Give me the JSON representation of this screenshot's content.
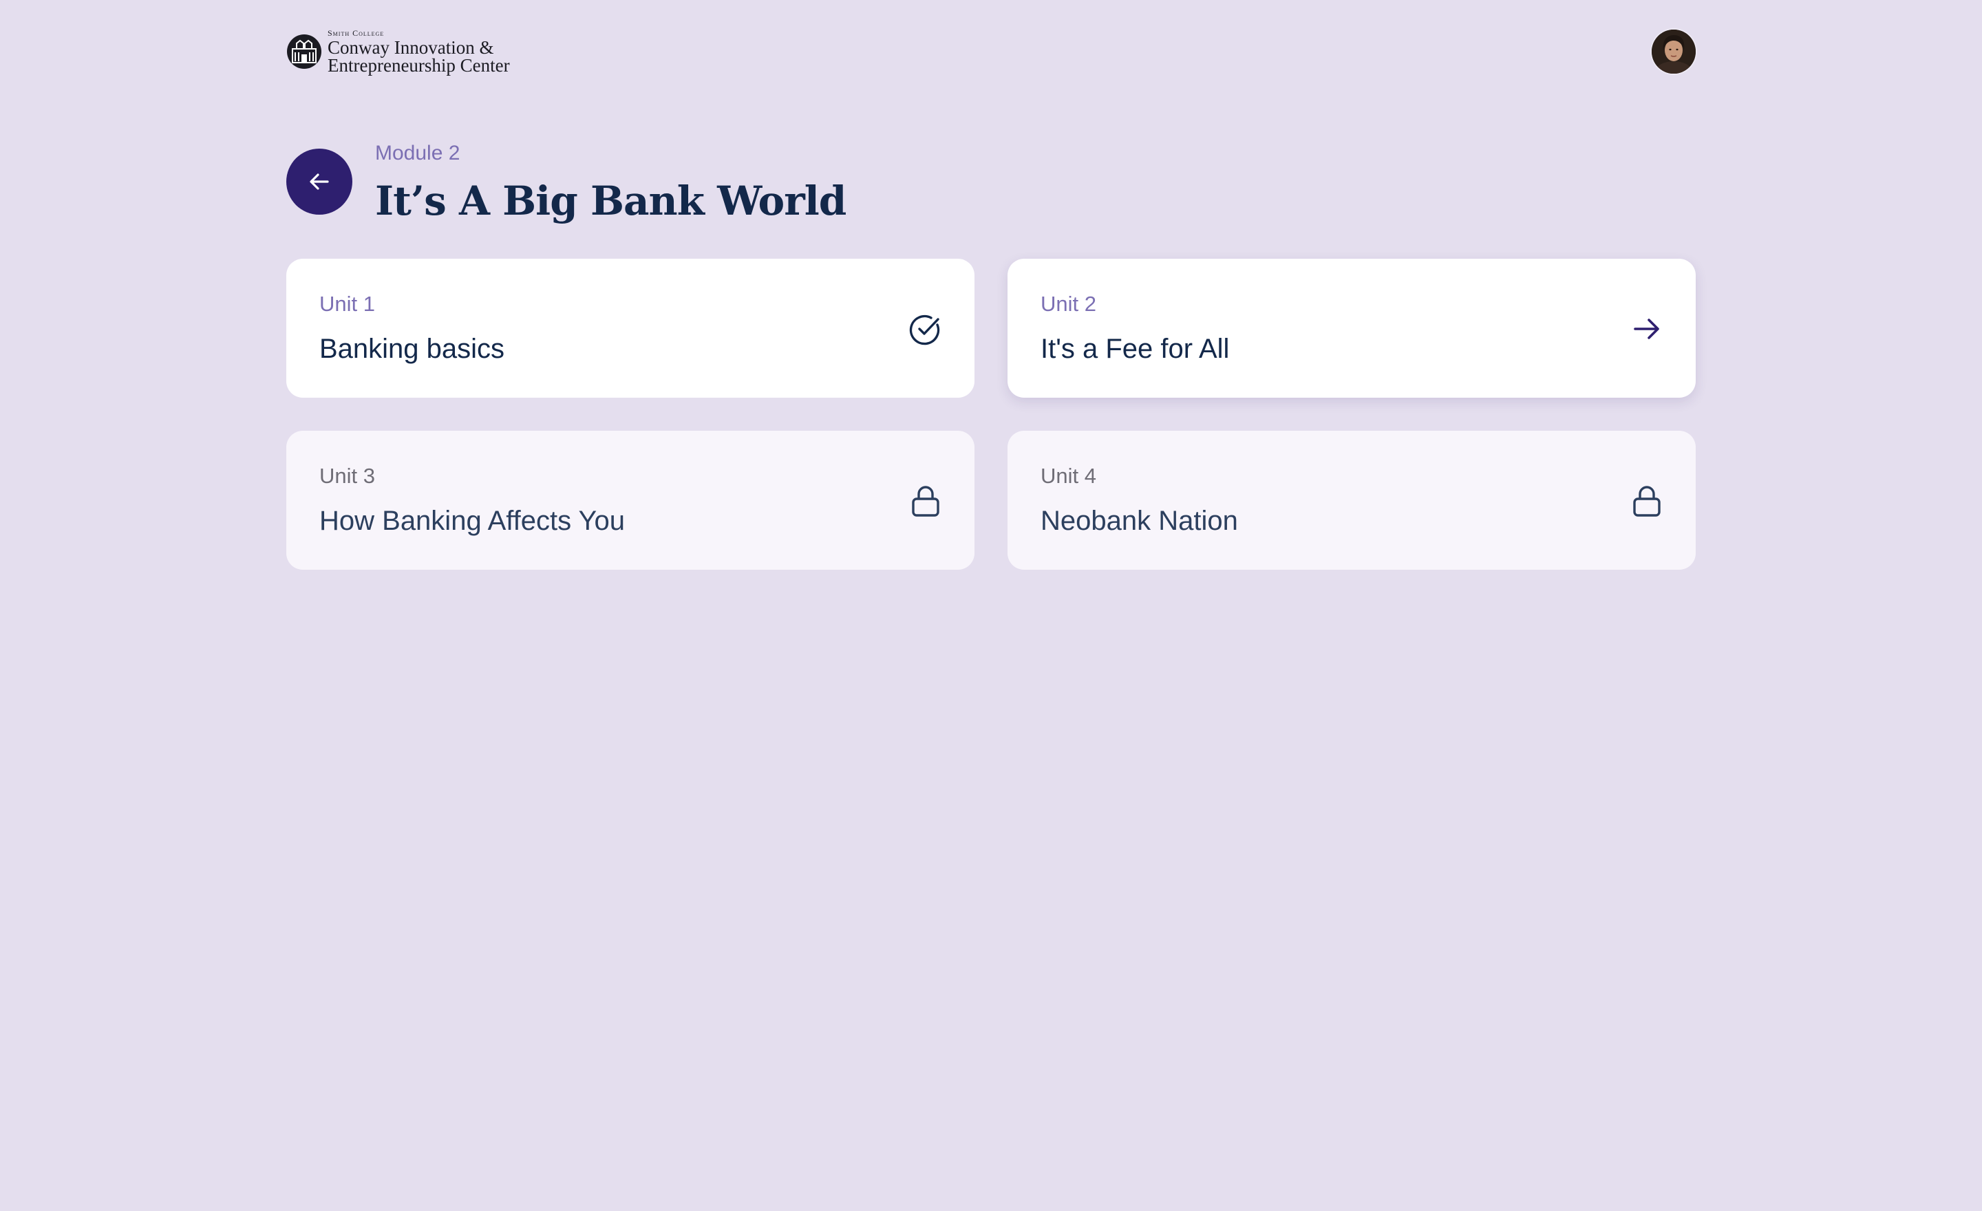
{
  "header": {
    "logo": {
      "small_text": "Smith College",
      "line1": "Conway Innovation &",
      "line2": "Entrepreneurship Center"
    },
    "avatar_icon": "user-avatar"
  },
  "module": {
    "label": "Module 2",
    "title": "It’s A Big Bank World",
    "back_icon": "arrow-left-icon"
  },
  "units": [
    {
      "label": "Unit 1",
      "title": "Banking basics",
      "status": "completed",
      "icon": "check-circle-icon"
    },
    {
      "label": "Unit 2",
      "title": "It's a Fee for All",
      "status": "current",
      "icon": "arrow-right-icon"
    },
    {
      "label": "Unit 3",
      "title": "How Banking Affects You",
      "status": "locked",
      "icon": "lock-icon"
    },
    {
      "label": "Unit 4",
      "title": "Neobank Nation",
      "status": "locked",
      "icon": "lock-icon"
    }
  ],
  "colors": {
    "background": "#e4deee",
    "accent": "#2e1f6f",
    "label_purple": "#7b6fb3",
    "title_navy": "#13284a",
    "locked_card": "#f8f5fb"
  }
}
